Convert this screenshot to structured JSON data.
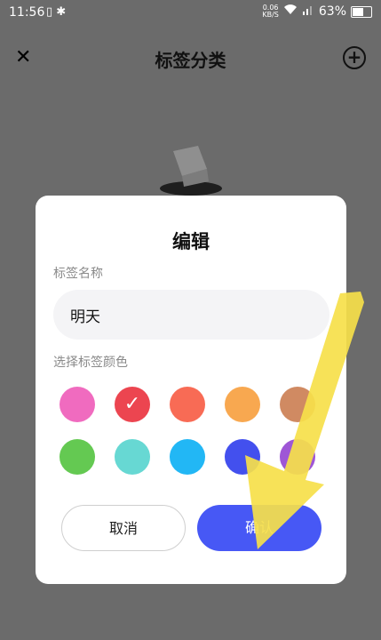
{
  "status_bar": {
    "time": "11:56",
    "net_speed_value": "0.06",
    "net_speed_unit": "KB/S",
    "battery": "63%"
  },
  "nav": {
    "title": "标签分类",
    "close_icon": "close-icon",
    "add_icon": "add-circle-icon"
  },
  "dialog": {
    "title": "编辑",
    "name_label": "标签名称",
    "name_value": "明天",
    "color_label": "选择标签颜色",
    "colors": [
      "#f06bbf",
      "#ec4550",
      "#f86b55",
      "#f8a850",
      "#d08a62",
      "#64c952",
      "#67d8d3",
      "#22b7f5",
      "#4350ee",
      "#9e56d6"
    ],
    "selected_color_index": 1,
    "cancel_label": "取消",
    "ok_label": "确认"
  }
}
